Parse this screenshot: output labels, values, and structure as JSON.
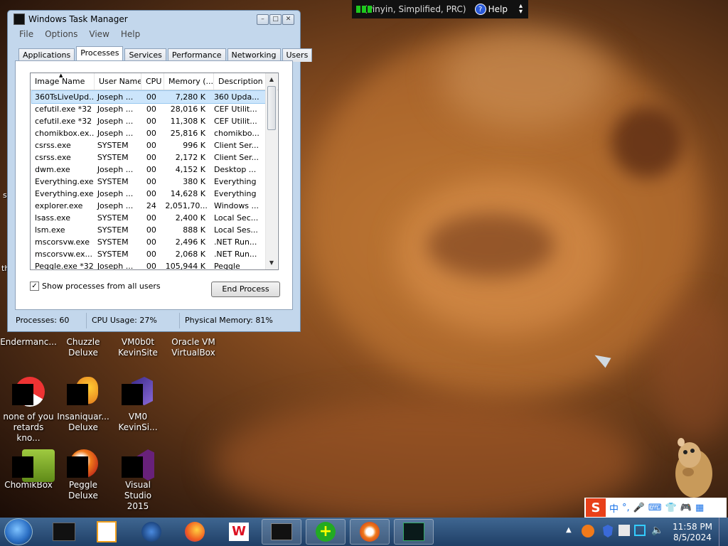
{
  "topbar": {
    "lang_text": "(Pinyin, Simplified, PRC)",
    "help_label": "Help"
  },
  "window": {
    "title": "Windows Task Manager",
    "menu": [
      "File",
      "Options",
      "View",
      "Help"
    ],
    "tabs": [
      "Applications",
      "Processes",
      "Services",
      "Performance",
      "Networking",
      "Users"
    ],
    "active_tab": "Processes",
    "columns": [
      "Image Name",
      "User Name",
      "CPU",
      "Memory (...",
      "Description"
    ],
    "processes": [
      [
        "360TsLiveUpd...",
        "Joseph ...",
        "00",
        "7,280 K",
        "360 Upda..."
      ],
      [
        "cefutil.exe *32",
        "Joseph ...",
        "00",
        "28,016 K",
        "CEF Utilit..."
      ],
      [
        "cefutil.exe *32",
        "Joseph ...",
        "00",
        "11,308 K",
        "CEF Utilit..."
      ],
      [
        "chomikbox.ex...",
        "Joseph ...",
        "00",
        "25,816 K",
        "chomikbo..."
      ],
      [
        "csrss.exe",
        "SYSTEM",
        "00",
        "996 K",
        "Client Ser..."
      ],
      [
        "csrss.exe",
        "SYSTEM",
        "00",
        "2,172 K",
        "Client Ser..."
      ],
      [
        "dwm.exe",
        "Joseph ...",
        "00",
        "4,152 K",
        "Desktop ..."
      ],
      [
        "Everything.exe",
        "SYSTEM",
        "00",
        "380 K",
        "Everything"
      ],
      [
        "Everything.exe",
        "Joseph ...",
        "00",
        "14,628 K",
        "Everything"
      ],
      [
        "explorer.exe",
        "Joseph ...",
        "24",
        "2,051,70...",
        "Windows ..."
      ],
      [
        "lsass.exe",
        "SYSTEM",
        "00",
        "2,400 K",
        "Local Sec..."
      ],
      [
        "lsm.exe",
        "SYSTEM",
        "00",
        "888 K",
        "Local Ses..."
      ],
      [
        "mscorsvw.exe",
        "SYSTEM",
        "00",
        "2,496 K",
        ".NET Run..."
      ],
      [
        "mscorsvw.ex...",
        "SYSTEM",
        "00",
        "2,068 K",
        ".NET Run..."
      ],
      [
        "Peggle.exe *32",
        "Joseph ...",
        "00",
        "105,944 K",
        "Peggle"
      ]
    ],
    "show_all_label": "Show processes from all users",
    "show_all_checked": true,
    "end_process_label": "End Process",
    "status": {
      "processes": "Processes: 60",
      "cpu": "CPU Usage: 27%",
      "memory": "Physical Memory: 81%"
    }
  },
  "desktop_icons": [
    {
      "label": "Endermanc...",
      "icon": "endermanch-icon"
    },
    {
      "label": "Chuzzle Deluxe",
      "icon": "chuzzle-icon"
    },
    {
      "label": "VM0b0t KevinSite",
      "icon": "vm-icon"
    },
    {
      "label": "Oracle VM VirtualBox",
      "icon": "virtualbox-icon"
    },
    {
      "label": "none of you retards kno...",
      "icon": "chrome-icon"
    },
    {
      "label": "Insaniquar... Deluxe",
      "icon": "insaniquarium-icon"
    },
    {
      "label": "VM0 KevinSi...",
      "icon": "vm-icon"
    },
    {
      "label": "ChomikBox",
      "icon": "chomikbox-icon"
    },
    {
      "label": "Peggle Deluxe",
      "icon": "peggle-icon"
    },
    {
      "label": "Visual Studio 2015",
      "icon": "visual-studio-icon"
    }
  ],
  "edge_texts": [
    "s",
    "th"
  ],
  "ime": {
    "logo": "S",
    "items": [
      "中",
      "°,",
      "mic",
      "keyboard",
      "shirt",
      "game",
      "grid"
    ]
  },
  "taskbar": {
    "items": [
      "terminal-icon",
      "media-player-icon",
      "browser-globe-icon",
      "firefox-icon",
      "wps-icon",
      "task-manager-icon",
      "plus-app-icon",
      "peggle-app-icon",
      "monitor-app-icon"
    ],
    "clock_time": "11:58 PM",
    "clock_date": "8/5/2024"
  }
}
